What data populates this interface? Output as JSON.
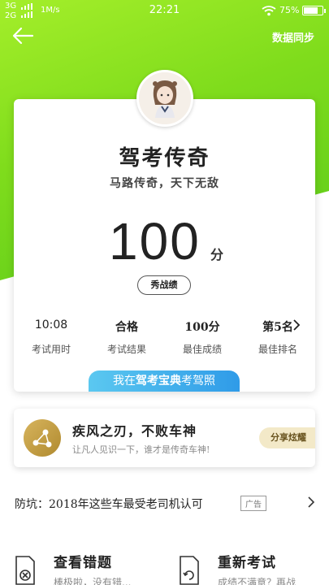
{
  "status_bar": {
    "network_top": "3G",
    "network_bottom": "2G",
    "speed": "1M/s",
    "time": "22:21",
    "battery": "75%",
    "battery_level": 0.75
  },
  "nav": {
    "sync_label": "数据同步"
  },
  "card": {
    "title": "驾考传奇",
    "subtitle": "马路传奇，天下无敌",
    "score": "100",
    "score_unit": "分",
    "show_button": "秀战绩",
    "stats": [
      {
        "value": "10:08",
        "label": "考试用时"
      },
      {
        "value": "合格",
        "label": "考试结果"
      },
      {
        "value": "100分",
        "label": "最佳成绩"
      },
      {
        "value": "第5名",
        "label": "最佳排名"
      }
    ],
    "banner_prefix": "我在",
    "banner_brand": "驾考宝典",
    "banner_suffix": "考驾照"
  },
  "promo": {
    "title": "疾风之刃，不败车神",
    "subtitle": "让凡人见识一下，谁才是传奇车神!",
    "share_button": "分享炫耀"
  },
  "ad": {
    "text": "防坑：2018年这些车最受老司机认可",
    "tag": "广告"
  },
  "actions": [
    {
      "title": "查看错题",
      "subtitle": "棒极啦，没有错..."
    },
    {
      "title": "重新考试",
      "subtitle": "成绩不满意？再战"
    }
  ],
  "colors": {
    "accent_green": "#7fdc1c",
    "banner_blue": "#2f9be8",
    "gold": "#c9a246"
  }
}
